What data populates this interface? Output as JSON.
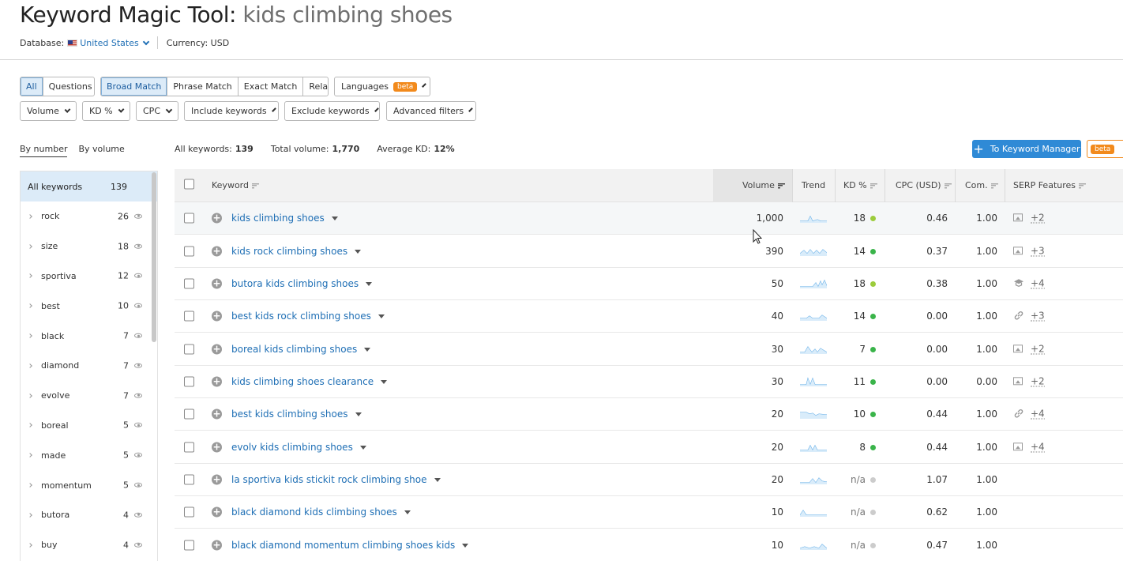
{
  "header": {
    "title_prefix": "Keyword Magic Tool:",
    "title_query": "kids climbing shoes",
    "database_label": "Database:",
    "database_value": "United States",
    "currency": "Currency: USD"
  },
  "match_tabs": {
    "all": "All",
    "questions": "Questions",
    "broad": "Broad Match",
    "phrase": "Phrase Match",
    "exact": "Exact Match",
    "related": "Related",
    "languages": "Languages",
    "beta": "beta"
  },
  "filters": {
    "volume": "Volume",
    "kd": "KD %",
    "cpc": "CPC",
    "include": "Include keywords",
    "exclude": "Exclude keywords",
    "advanced": "Advanced filters"
  },
  "group_tabs": {
    "by_number": "By number",
    "by_volume": "By volume"
  },
  "stats": {
    "all_keywords_label": "All keywords:",
    "all_keywords_value": "139",
    "total_volume_label": "Total volume:",
    "total_volume_value": "1,770",
    "avg_kd_label": "Average KD:",
    "avg_kd_value": "12%"
  },
  "buttons": {
    "keyword_manager": "To Keyword Manager",
    "beta": "beta"
  },
  "sidebar": {
    "all_label": "All keywords",
    "all_count": "139",
    "items": [
      {
        "label": "rock",
        "count": "26"
      },
      {
        "label": "size",
        "count": "18"
      },
      {
        "label": "sportiva",
        "count": "12"
      },
      {
        "label": "best",
        "count": "10"
      },
      {
        "label": "black",
        "count": "7"
      },
      {
        "label": "diamond",
        "count": "7"
      },
      {
        "label": "evolve",
        "count": "7"
      },
      {
        "label": "boreal",
        "count": "5"
      },
      {
        "label": "made",
        "count": "5"
      },
      {
        "label": "momentum",
        "count": "5"
      },
      {
        "label": "butora",
        "count": "4"
      },
      {
        "label": "buy",
        "count": "4"
      }
    ]
  },
  "table": {
    "headers": {
      "keyword": "Keyword",
      "volume": "Volume",
      "trend": "Trend",
      "kd": "KD %",
      "cpc": "CPC (USD)",
      "com": "Com.",
      "serp": "SERP Features"
    },
    "rows": [
      {
        "keyword": "kids climbing shoes",
        "volume": "1,000",
        "kd": "18",
        "kd_color": "#9ccc3c",
        "cpc": "0.46",
        "com": "1.00",
        "serp_icon": "image-icon",
        "serp_more": "+2"
      },
      {
        "keyword": "kids rock climbing shoes",
        "volume": "390",
        "kd": "14",
        "kd_color": "#3ab44a",
        "cpc": "0.37",
        "com": "1.00",
        "serp_icon": "image-icon",
        "serp_more": "+3"
      },
      {
        "keyword": "butora kids climbing shoes",
        "volume": "50",
        "kd": "18",
        "kd_color": "#9ccc3c",
        "cpc": "0.38",
        "com": "1.00",
        "serp_icon": "graduation-cap-icon",
        "serp_more": "+4"
      },
      {
        "keyword": "best kids rock climbing shoes",
        "volume": "40",
        "kd": "14",
        "kd_color": "#3ab44a",
        "cpc": "0.00",
        "com": "1.00",
        "serp_icon": "link-icon",
        "serp_more": "+3"
      },
      {
        "keyword": "boreal kids climbing shoes",
        "volume": "30",
        "kd": "7",
        "kd_color": "#3ab44a",
        "cpc": "0.00",
        "com": "1.00",
        "serp_icon": "image-icon",
        "serp_more": "+2"
      },
      {
        "keyword": "kids climbing shoes clearance",
        "volume": "30",
        "kd": "11",
        "kd_color": "#3ab44a",
        "cpc": "0.00",
        "com": "0.00",
        "serp_icon": "image-icon",
        "serp_more": "+2"
      },
      {
        "keyword": "best kids climbing shoes",
        "volume": "20",
        "kd": "10",
        "kd_color": "#3ab44a",
        "cpc": "0.44",
        "com": "1.00",
        "serp_icon": "link-icon",
        "serp_more": "+4"
      },
      {
        "keyword": "evolv kids climbing shoes",
        "volume": "20",
        "kd": "8",
        "kd_color": "#3ab44a",
        "cpc": "0.44",
        "com": "1.00",
        "serp_icon": "image-icon",
        "serp_more": "+4"
      },
      {
        "keyword": "la sportiva kids stickit rock climbing shoe",
        "volume": "20",
        "kd": "n/a",
        "kd_color": "#cccccc",
        "cpc": "1.07",
        "com": "1.00",
        "serp_icon": "",
        "serp_more": ""
      },
      {
        "keyword": "black diamond kids climbing shoes",
        "volume": "10",
        "kd": "n/a",
        "kd_color": "#cccccc",
        "cpc": "0.62",
        "com": "1.00",
        "serp_icon": "",
        "serp_more": ""
      },
      {
        "keyword": "black diamond momentum climbing shoes kids",
        "volume": "10",
        "kd": "n/a",
        "kd_color": "#cccccc",
        "cpc": "0.47",
        "com": "1.00",
        "serp_icon": "",
        "serp_more": ""
      }
    ]
  },
  "colors": {
    "accent": "#2f8ad6",
    "link": "#1f6fb5",
    "beta": "#f28a1c"
  }
}
